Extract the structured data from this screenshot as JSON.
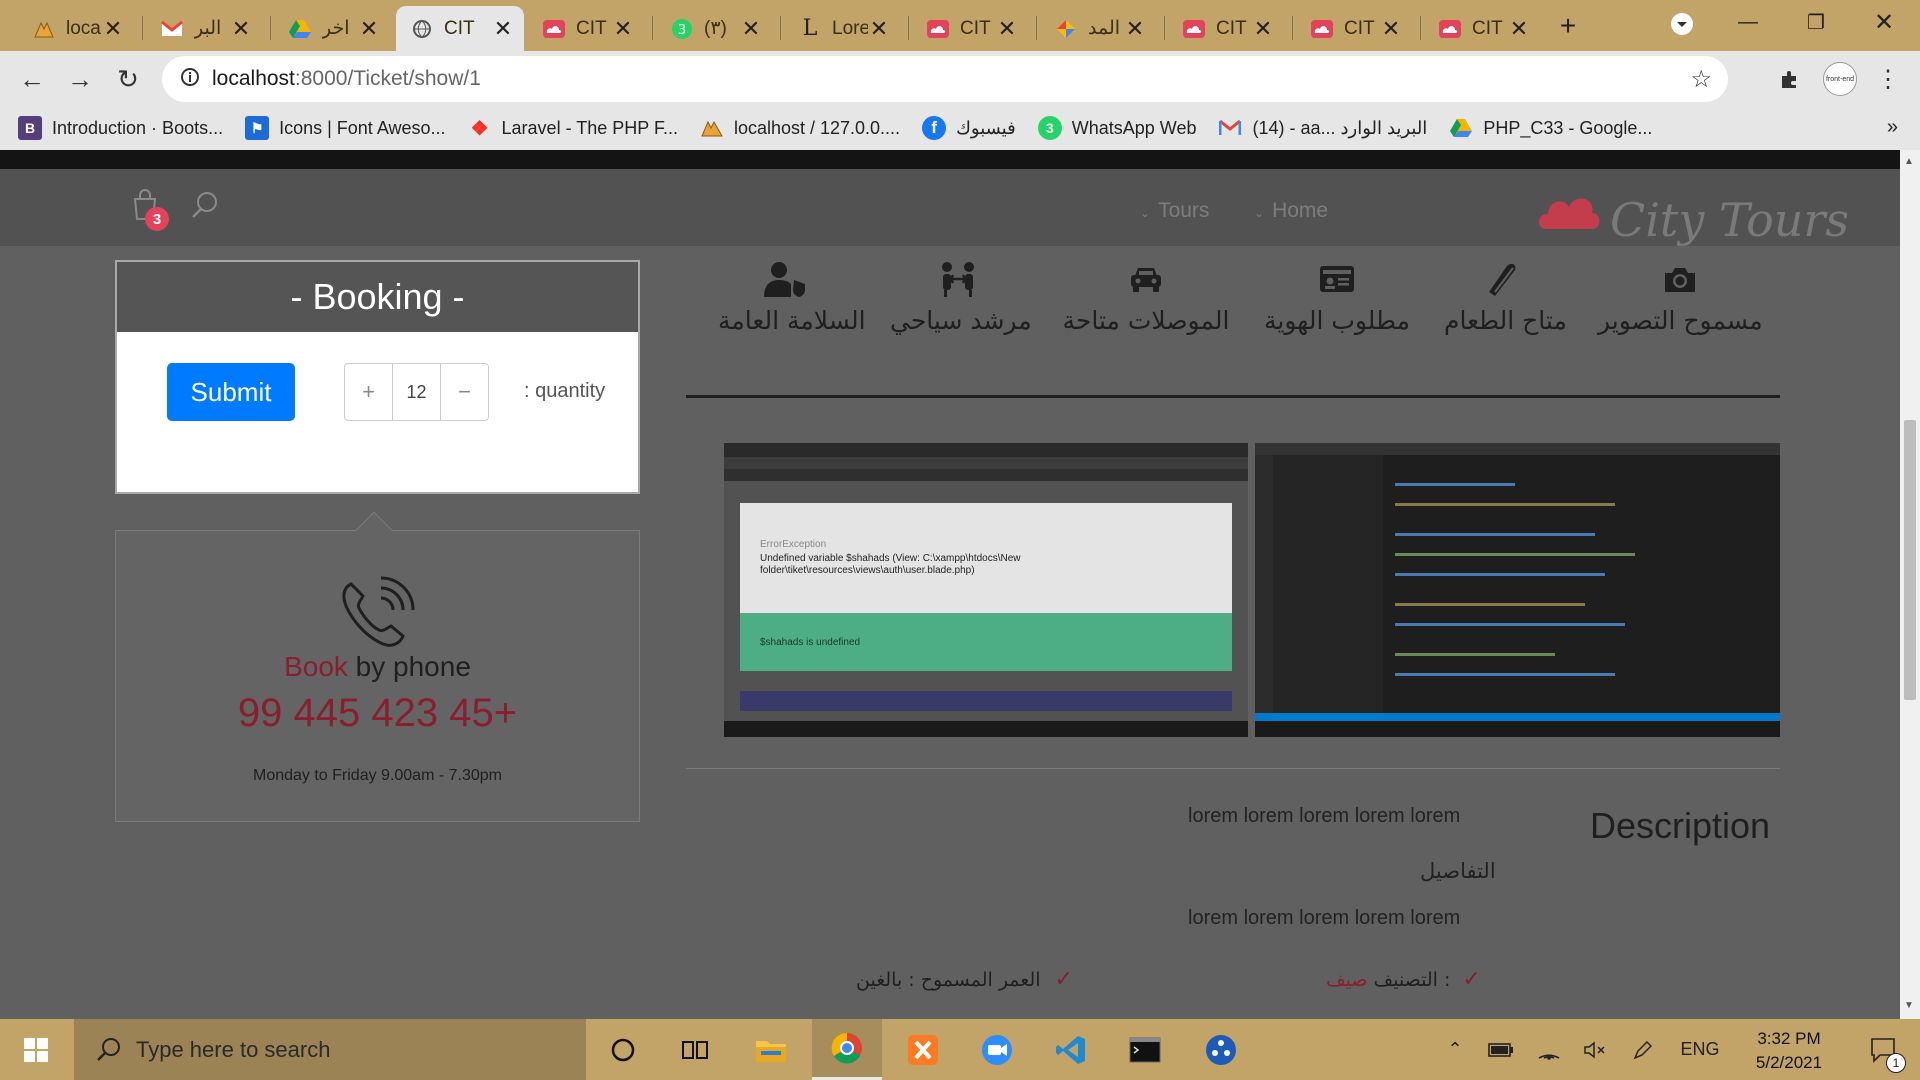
{
  "browser": {
    "tabs": [
      {
        "title": "loca",
        "icon": "xampp-icon"
      },
      {
        "title": "البر",
        "icon": "gmail-icon"
      },
      {
        "title": "اخر",
        "icon": "google-drive-icon"
      },
      {
        "title": "CIT",
        "icon": "globe-icon",
        "active": true
      },
      {
        "title": "CIT",
        "icon": "city-tours-icon"
      },
      {
        "title": "(٣)",
        "icon": "whatsapp-icon"
      },
      {
        "title": "Lore",
        "icon": "lorem-icon"
      },
      {
        "title": "CIT",
        "icon": "city-tours-icon"
      },
      {
        "title": "المد",
        "icon": "google-classroom-icon"
      },
      {
        "title": "CIT",
        "icon": "city-tours-icon"
      },
      {
        "title": "CIT",
        "icon": "city-tours-icon"
      },
      {
        "title": "CIT",
        "icon": "city-tours-icon"
      }
    ],
    "url_host": "localhost",
    "url_path": ":8000/Ticket/show/1",
    "profile_label": "front-end",
    "bookmarks": [
      {
        "label": "Introduction · Boots...",
        "icon": "bootstrap-icon",
        "color": "#563d7c",
        "glyph": "B"
      },
      {
        "label": "Icons | Font Aweso...",
        "icon": "font-awesome-icon",
        "color": "#1c6bd6",
        "glyph": "⚑"
      },
      {
        "label": "Laravel - The PHP F...",
        "icon": "laravel-icon",
        "color": "#ff2d20",
        "glyph": "L"
      },
      {
        "label": "localhost / 127.0.0....",
        "icon": "phpmyadmin-icon",
        "color": "#e8a33b",
        "glyph": "▲"
      },
      {
        "label": "فيسبوك",
        "icon": "facebook-icon",
        "color": "#1877f2",
        "glyph": "f"
      },
      {
        "label": "WhatsApp Web",
        "icon": "whatsapp-icon",
        "color": "#25d366",
        "glyph": "3"
      },
      {
        "label": "(14) - aa... البريد الوارد",
        "icon": "gmail-icon",
        "color": "#ea4335",
        "glyph": "M"
      },
      {
        "label": "PHP_C33 - Google...",
        "icon": "google-drive-icon",
        "color": "#f4b400",
        "glyph": "▲"
      }
    ]
  },
  "site": {
    "cart_count": "3",
    "nav": {
      "tours": "Tours",
      "home": "Home"
    },
    "logo": "City Tours",
    "booking": {
      "title": "- Booking -",
      "submit": "Submit",
      "quantity_value": "12",
      "quantity_label": ": quantity",
      "plus": "+",
      "minus": "−"
    },
    "phone": {
      "title_accent": "Book",
      "title_rest": " by phone",
      "number": "99 445 423 45+",
      "hours": "Monday to Friday 9.00am - 7.30pm"
    },
    "features": [
      {
        "label": "السلامة العامة",
        "icon": "user-shield-icon"
      },
      {
        "label": "مرشد سياحي",
        "icon": "tour-guide-icon"
      },
      {
        "label": "الموصلات متاحة",
        "icon": "car-icon"
      },
      {
        "label": "مطلوب الهوية",
        "icon": "id-card-icon"
      },
      {
        "label": "متاح الطعام",
        "icon": "cutlery-icon"
      },
      {
        "label": "مسموح التصوير",
        "icon": "camera-icon"
      }
    ],
    "screenshot_left": {
      "error_type": "ErrorException",
      "error_msg": "Undefined variable $shahads (View: C:\\xampp\\htdocs\\New folder\\tiket\\resources\\views\\auth\\user.blade.php)",
      "bar_msg": "$shahads is undefined"
    },
    "description": {
      "title": "Description",
      "line1": "lorem lorem lorem lorem lorem",
      "details_label": "التفاصيل",
      "line2": "lorem lorem lorem lorem lorem"
    },
    "meta": {
      "category_label": "التصنيف : ",
      "category_value": "صيف",
      "age_label": "العمر المسموح : بالغين"
    }
  },
  "taskbar": {
    "search_placeholder": "Type here to search",
    "language": "ENG",
    "time": "3:32 PM",
    "date": "5/2/2021",
    "notification_count": "1"
  },
  "colors": {
    "accent_red": "#8a1e2e",
    "submit_blue": "#007bff",
    "chrome_frame": "#c2a368"
  }
}
